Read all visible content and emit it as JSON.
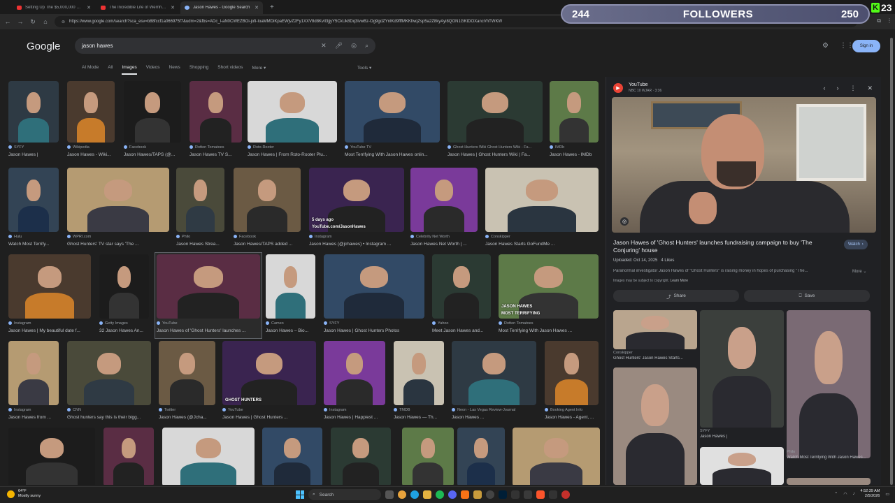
{
  "browser": {
    "tabs": [
      {
        "label": "Setting Up The $5,000,000 Str...",
        "favicon": "youtube-icon",
        "active": false
      },
      {
        "label": "The Incredible Life of Wernher von...",
        "favicon": "youtube-icon",
        "active": false
      },
      {
        "label": "Jason Hawes - Google Search",
        "favicon": "google-icon",
        "active": true
      }
    ],
    "url": "https://www.google.com/search?sca_esv=b88fccf1a066975f7&udm=2&fbs=ADc_l-aN0CWEZBOi-jofi-IoaMMDiKpaEWjvZ2Fy1XXV8d8KvlI3jjyY5CkUk8Dq3lvwBz-Og9gdZYnlKd9fffMKKfwqZsp5a2Z8kyAyi8QON1GKtDOXancVhTWKW"
  },
  "overlay": {
    "followers_current": "244",
    "followers_label": "FOLLOWERS",
    "followers_goal": "250",
    "viewer_count": "23"
  },
  "google": {
    "logo": "Google",
    "query": "jason hawes",
    "filters": [
      "AI Mode",
      "All",
      "Images",
      "Videos",
      "News",
      "Shopping",
      "Short videos",
      "More ▾"
    ],
    "active_filter": "Images",
    "tools": "Tools ▾",
    "signin": "Sign in"
  },
  "results": [
    [
      {
        "src": "SYFY",
        "title": "Jason Hawes |"
      },
      {
        "src": "Wikipedia",
        "title": "Jason Hawes - Wiki..."
      },
      {
        "src": "Facebook",
        "title": "Jason Hawes/TAPS (@..."
      },
      {
        "src": "Rotten Tomatoes",
        "title": "Jason Hawes TV S..."
      },
      {
        "src": "Roto-Rooter",
        "title": "Jason Hawes | From Roto-Rooter Plu..."
      },
      {
        "src": "YouTube TV",
        "title": "Most Terrifying With Jason Hawes onlin..."
      },
      {
        "src": "Ghost Hunters Wiki Ghost Hunters Wiki - Fa...",
        "title": "Jason Hawes | Ghost Hunters Wiki | Fa..."
      },
      {
        "src": "IMDb",
        "title": "Jason Hawes - IMDb"
      }
    ],
    [
      {
        "src": "Hulu",
        "title": "Watch Most Terrify..."
      },
      {
        "src": "WPRI.com",
        "title": "Ghost Hunters' TV star says 'The ..."
      },
      {
        "src": "Philo",
        "title": "Jason Hawes Strea..."
      },
      {
        "src": "Facebook",
        "title": "Jason Hawes/TAPS added ..."
      },
      {
        "src": "Instagram",
        "title": "Jason Hawes (@jchawes) • Instagram ..."
      },
      {
        "src": "Celebrity Net Worth",
        "title": "Jason Hawes Net Worth | ..."
      },
      {
        "src": "Conskipper",
        "title": "Jason Hawes Starts GoFundMe ..."
      }
    ],
    [
      {
        "src": "Instagram",
        "title": "Jason Hawes | My beautiful date f..."
      },
      {
        "src": "Getty Images",
        "title": "32 Jason Hawes An..."
      },
      {
        "src": "YouTube",
        "title": "Jason Hawes of 'Ghost Hunters' launches ..."
      },
      {
        "src": "Cameo",
        "title": "Jason Hawes – Bio..."
      },
      {
        "src": "SYFY",
        "title": "Jason Hawes | Ghost Hunters Photos"
      },
      {
        "src": "Yahoo",
        "title": "Meet Jason Hawes and..."
      },
      {
        "src": "Rotten Tomatoes",
        "title": "Most Terrifying With Jason Hawes ..."
      }
    ],
    [
      {
        "src": "Instagram",
        "title": "Jason Hawes from ..."
      },
      {
        "src": "CNN",
        "title": "Ghost hunters say this is their bigg..."
      },
      {
        "src": "Twitter",
        "title": "Jason Hawes (@Jcha..."
      },
      {
        "src": "YouTube",
        "title": "Jason Hawes | Ghost Hunters ..."
      },
      {
        "src": "Instagram",
        "title": "Jason Hawes | Happiest ..."
      },
      {
        "src": "TMDB",
        "title": "Jason Hawes — Th..."
      },
      {
        "src": "Neon - Las Vegas Review-Journal",
        "title": "Jason Hawes ..."
      },
      {
        "src": "Booking Agent Info",
        "title": "Jason Hawes - Agent, ..."
      }
    ]
  ],
  "thumb_overlays": {
    "youtube_channel": "YouTube.com/JasonHawes",
    "days_ago": "5 days ago",
    "most_terrifying": "MOST TERRIFYING",
    "jason_hawes_caps": "JASON HAWES",
    "ghost_hunters": "GHOST HUNTERS",
    "scifi": "Sci Fi"
  },
  "panel": {
    "source": "YouTube",
    "source_sub": "NBC 10 WJAR · 3:36",
    "title": "Jason Hawes of 'Ghost Hunters' launches fundraising campaign to buy 'The Conjuring' house",
    "watch": "Watch",
    "uploaded": "Uploaded: Oct 14, 2025",
    "likes": "4 Likes",
    "description": "Paranormal investigator Jason Hawes of \"Ghost Hunters\" is raising money in hopes of purchasing \"The...",
    "more": "More",
    "copyright": "Images may be subject to copyright.",
    "learn_more": "Learn More",
    "share": "Share",
    "save": "Save",
    "related": [
      {
        "src": "Conskipper",
        "title": "Ghost Hunters' Jason Hawes Starts..."
      },
      {
        "src": "",
        "title": ""
      },
      {
        "src": "",
        "title": ""
      },
      {
        "src": "",
        "title": ""
      },
      {
        "src": "SYFY",
        "title": "Jason Hawes |"
      },
      {
        "src": "Philo",
        "title": "Watch Most Terrifying With Jason Hawes..."
      }
    ]
  },
  "taskbar": {
    "temp": "64°F",
    "weather": "Mostly sunny",
    "search": "Search",
    "time": "4:52:39 AM",
    "date": "2/5/2026"
  }
}
